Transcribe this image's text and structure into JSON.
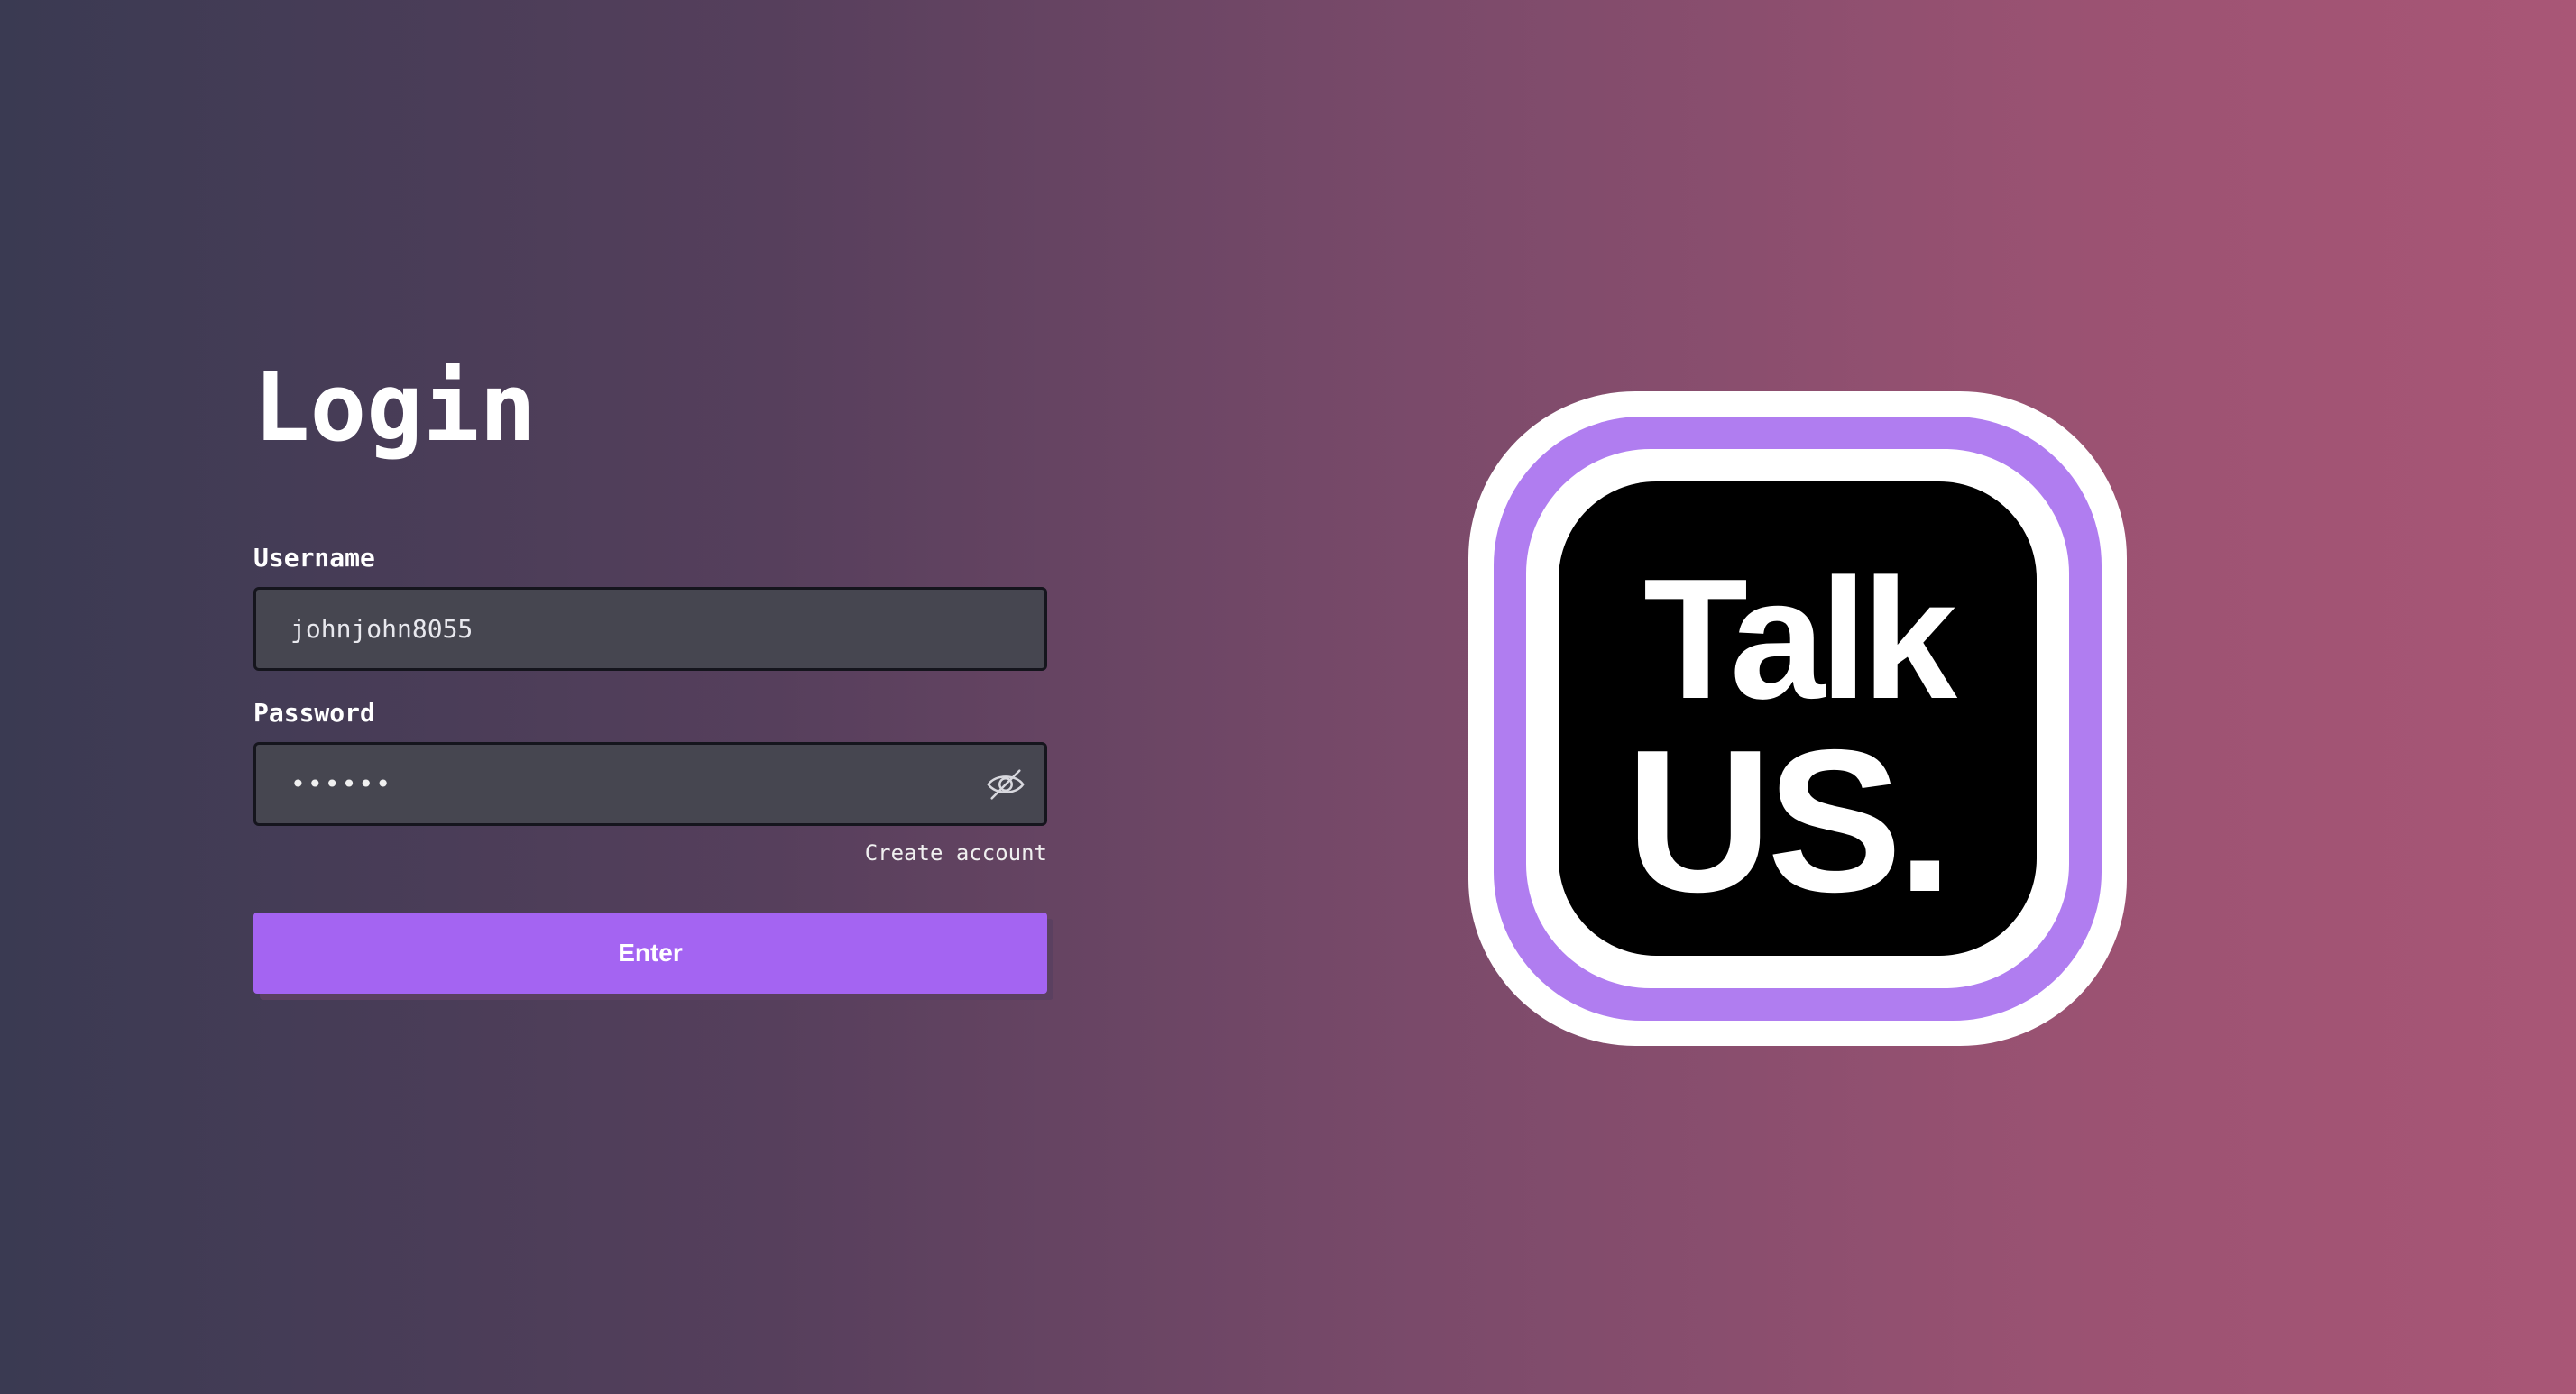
{
  "login": {
    "title": "Login",
    "username_label": "Username",
    "username_value": "johnjohn8055",
    "password_label": "Password",
    "password_masked": "••••••",
    "create_account_label": "Create account",
    "enter_label": "Enter"
  },
  "logo": {
    "line1": "Talk",
    "line2": "US."
  },
  "colors": {
    "accent": "#a464f2",
    "logo_ring": "#b07df0",
    "logo_bg": "#000000"
  },
  "icons": {
    "password_toggle": "eye-slash-icon"
  }
}
